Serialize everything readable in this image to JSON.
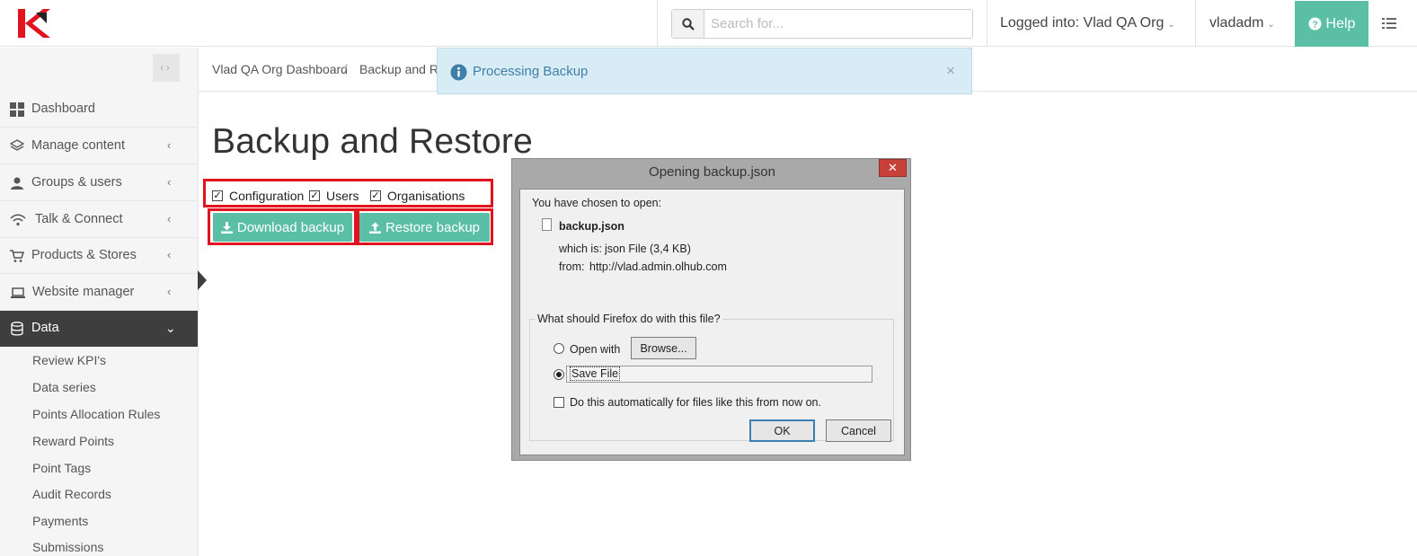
{
  "header": {
    "search_placeholder": "Search for...",
    "logged_in_label": "Logged into: Vlad QA Org",
    "user_name": "vladadm",
    "help_label": "Help",
    "colors": {
      "accent": "#5bbfa5",
      "logo_red": "#e0131e"
    }
  },
  "sidebar": {
    "items": [
      {
        "label": "Dashboard",
        "icon": "dashboard-icon"
      },
      {
        "label": "Manage content",
        "icon": "layers-icon"
      },
      {
        "label": "Groups & users",
        "icon": "user-icon"
      },
      {
        "label": "Talk & Connect",
        "icon": "wifi-icon"
      },
      {
        "label": "Products & Stores",
        "icon": "cart-icon"
      },
      {
        "label": "Website manager",
        "icon": "laptop-icon"
      },
      {
        "label": "Data",
        "icon": "database-icon"
      }
    ],
    "data_subitems": [
      "Review KPI's",
      "Data series",
      "Points Allocation Rules",
      "Reward Points",
      "Point Tags",
      "Audit Records",
      "Payments",
      "Submissions"
    ]
  },
  "breadcrumb": {
    "items": [
      "Vlad QA Org Dashboard",
      "Backup and Re"
    ]
  },
  "alert": {
    "message": "Processing Backup"
  },
  "main": {
    "title": "Backup and Restore",
    "options": [
      "Configuration",
      "Users",
      "Organisations"
    ],
    "download_label": "Download backup",
    "restore_label": "Restore backup"
  },
  "dialog": {
    "title": "Opening backup.json",
    "chosen_label": "You have chosen to open:",
    "file_name": "backup.json",
    "which_is_label": "which is:",
    "which_is_value": "json File (3,4 KB)",
    "from_label": "from:",
    "from_value": "http://vlad.admin.olhub.com",
    "question": "What should Firefox do with this file?",
    "open_with_label": "Open with",
    "browse_label": "Browse...",
    "save_file_label": "Save File",
    "auto_label": "Do this automatically for files like this from now on.",
    "ok_label": "OK",
    "cancel_label": "Cancel"
  }
}
